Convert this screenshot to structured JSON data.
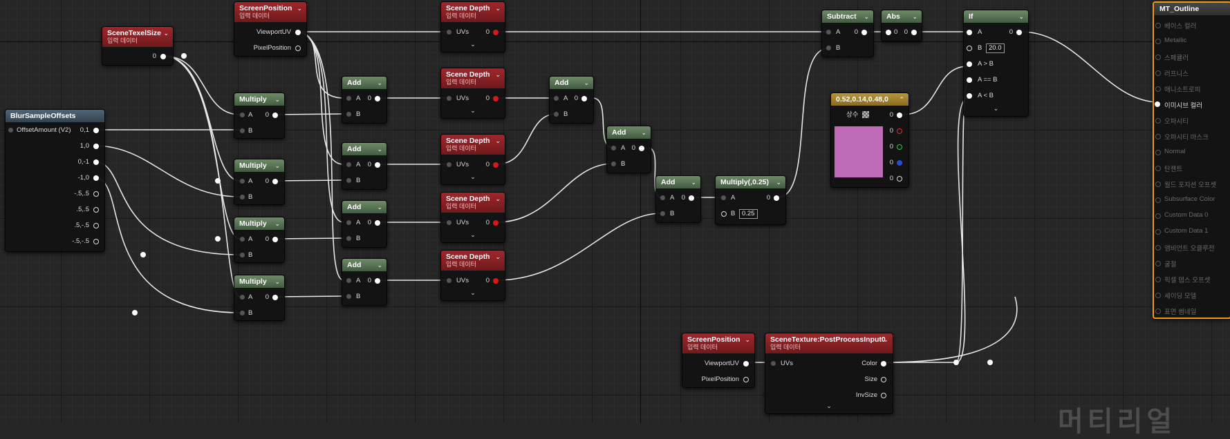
{
  "nodes": {
    "scene_texel_size": {
      "title": "SceneTexelSize",
      "subtitle": "입력 데이터",
      "out": "0"
    },
    "screen_position_top": {
      "title": "ScreenPosition",
      "subtitle": "입력 데이터",
      "out1": "ViewportUV",
      "out2": "PixelPosition"
    },
    "blur_offsets": {
      "title": "BlurSampleOffsets",
      "input": "OffsetAmount (V2)",
      "outs": [
        "0,1",
        "1,0",
        "0,-1",
        "-1,0",
        "-.5,.5",
        ".5,.5",
        ".5,-.5",
        "-.5,-.5"
      ]
    },
    "multiply_label": "Multiply",
    "add_label": "Add",
    "scene_depth": {
      "title": "Scene Depth",
      "subtitle": "입력 데이터",
      "in": "UVs",
      "out": "0"
    },
    "pin_a": "A",
    "pin_b": "B",
    "zero": "0",
    "subtract": {
      "title": "Subtract",
      "a": "A",
      "b": "B"
    },
    "abs": {
      "title": "Abs",
      "in": "0",
      "out": "0"
    },
    "if_node": {
      "title": "If",
      "a": "A",
      "b": "B",
      "b_value": "20.0",
      "agtb": "A > B",
      "aeqb": "A == B",
      "altb": "A < B"
    },
    "constant": {
      "title": "0.52,0.14,0.48,0",
      "label": "상수",
      "swatch": "#bd6bb7"
    },
    "multiply_quarter": {
      "title": "Multiply(,0.25)",
      "a": "A",
      "b": "B",
      "b_value": "0.25"
    },
    "screen_position_bottom": {
      "title": "ScreenPosition",
      "subtitle": "입력 데이터",
      "out1": "ViewportUV",
      "out2": "PixelPosition"
    },
    "scene_texture": {
      "title": "SceneTexture:PostProcessInput0",
      "subtitle": "입력 데이터",
      "in": "UVs",
      "outs": [
        "Color",
        "Size",
        "InvSize"
      ]
    },
    "material": {
      "title": "MT_Outline",
      "pins": [
        "베이스 컬러",
        "Metallic",
        "스페큘러",
        "러프니스",
        "애니소트로피",
        "이미시브 컬러",
        "오파시티",
        "오파시티 마스크",
        "Normal",
        "탄젠트",
        "월드 포지션 오프셋",
        "Subsurface Color",
        "Custom Data 0",
        "Custom Data 1",
        "앰비언트 오클루전",
        "굴절",
        "픽셀 뎁스 오프셋",
        "셰이딩 모델",
        "표면 썸네일"
      ]
    }
  },
  "watermark": "머티리얼",
  "colors": {
    "accent": "#f09a1a",
    "wire": "#e8e8e8",
    "red_header": "#a0262b",
    "green_header": "#6e8c68"
  }
}
